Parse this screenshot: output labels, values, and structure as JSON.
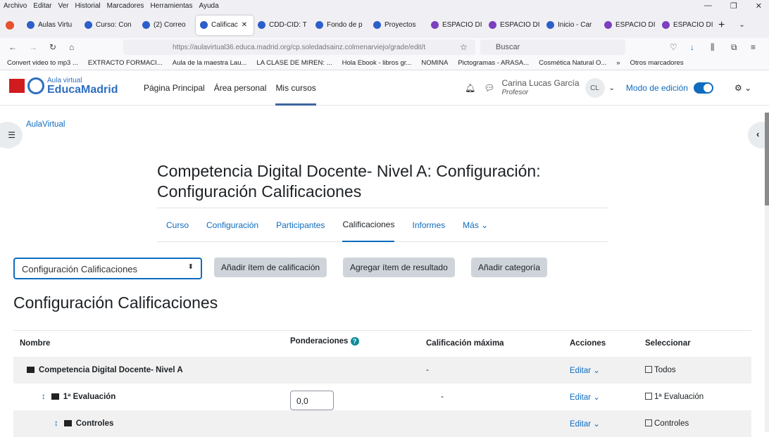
{
  "menubar": [
    "Archivo",
    "Editar",
    "Ver",
    "Historial",
    "Marcadores",
    "Herramientas",
    "Ayuda"
  ],
  "tabs": [
    "Aulas Virtu",
    "Curso: Con",
    "(2) Correo",
    "Calificac",
    "CDD-CID: T",
    "Fondo de p",
    "Proyectos",
    "ESPACIO DI",
    "ESPACIO DI",
    "Inicio - Car",
    "ESPACIO DI",
    "ESPACIO DI"
  ],
  "url": "https://aulavirtual36.educa.madrid.org/cp.soledadsainz.colmenarviejo/grade/edit/t",
  "search_placeholder": "Buscar",
  "bookmarks": [
    "Convert video to mp3 ...",
    "EXTRACTO FORMACI...",
    "Aula de la maestra Lau...",
    "LA CLASE DE MIREN: ...",
    "Hola Ebook - libros gr...",
    "NOMINA",
    "Pictogramas - ARASA...",
    "Cosmética Natural O...",
    "Otros marcadores"
  ],
  "logo": {
    "line1": "Aula virtual",
    "line2": "EducaMadrid"
  },
  "nav": [
    "Página Principal",
    "Área personal",
    "Mis cursos"
  ],
  "user": {
    "name": "Carina Lucas García",
    "role": "Profesor",
    "initials": "CL"
  },
  "edit_mode": {
    "label": "Modo de edición",
    "on": true
  },
  "breadcrumb": "AulaVirtual",
  "title": "Competencia Digital Docente- Nivel A: Configuración: Configuración Calificaciones",
  "course_tabs": [
    "Curso",
    "Configuración",
    "Participantes",
    "Calificaciones",
    "Informes",
    "Más"
  ],
  "select_value": "Configuración Calificaciones",
  "buttons": [
    "Añadir ítem de calificación",
    "Agregar ítem de resultado",
    "Añadir categoría"
  ],
  "section_title": "Configuración Calificaciones",
  "table": {
    "headers": [
      "Nombre",
      "Ponderaciones",
      "Calificación máxima",
      "Acciones",
      "Seleccionar"
    ],
    "rows": [
      {
        "name": "Competencia Digital Docente- Nivel A",
        "weight": "",
        "max": "-",
        "action": "Editar",
        "select": "Todos"
      },
      {
        "name": "1ª Evaluación",
        "weight": "0,0",
        "max": "-",
        "action": "Editar",
        "select": "1ª Evaluación"
      },
      {
        "name": "Controles",
        "weight": "",
        "max": "",
        "action": "Editar",
        "select": "Controles"
      }
    ]
  }
}
